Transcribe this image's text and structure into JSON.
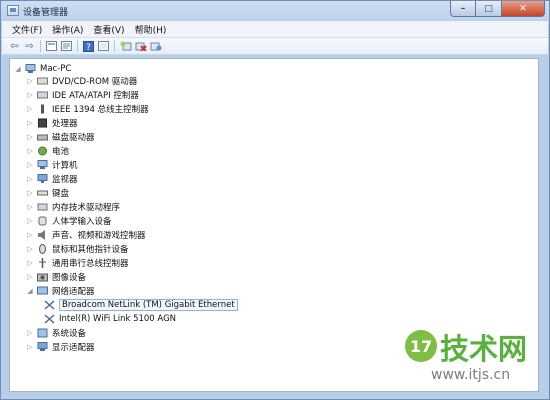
{
  "window": {
    "title": "设备管理器",
    "min_glyph": "–",
    "max_glyph": "□",
    "close_glyph": "✕"
  },
  "menu": {
    "items": [
      "文件(F)",
      "操作(A)",
      "查看(V)",
      "帮助(H)"
    ]
  },
  "toolbar": {
    "icons": [
      "back-arrow-icon",
      "forward-arrow-icon",
      "show-hidden-icon",
      "properties-icon",
      "help-icon",
      "scan-icon",
      "update-driver-icon",
      "disable-device-icon",
      "uninstall-device-icon"
    ]
  },
  "tree": {
    "root": "Mac-PC",
    "categories": [
      "DVD/CD-ROM 驱动器",
      "IDE ATA/ATAPI 控制器",
      "IEEE 1394 总线主控制器",
      "处理器",
      "磁盘驱动器",
      "电池",
      "计算机",
      "监视器",
      "键盘",
      "内存技术驱动程序",
      "人体学输入设备",
      "声音、视频和游戏控制器",
      "鼠标和其他指针设备",
      "通用串行总线控制器",
      "图像设备",
      "网络适配器"
    ],
    "network_children": [
      "Broadcom NetLink (TM) Gigabit Ethernet",
      "Intel(R) WiFi Link 5100 AGN"
    ],
    "after_categories": [
      "系统设备",
      "显示适配器"
    ]
  },
  "watermark": {
    "number": "17",
    "brand": "技术网",
    "url": "www.itjs.cn"
  }
}
